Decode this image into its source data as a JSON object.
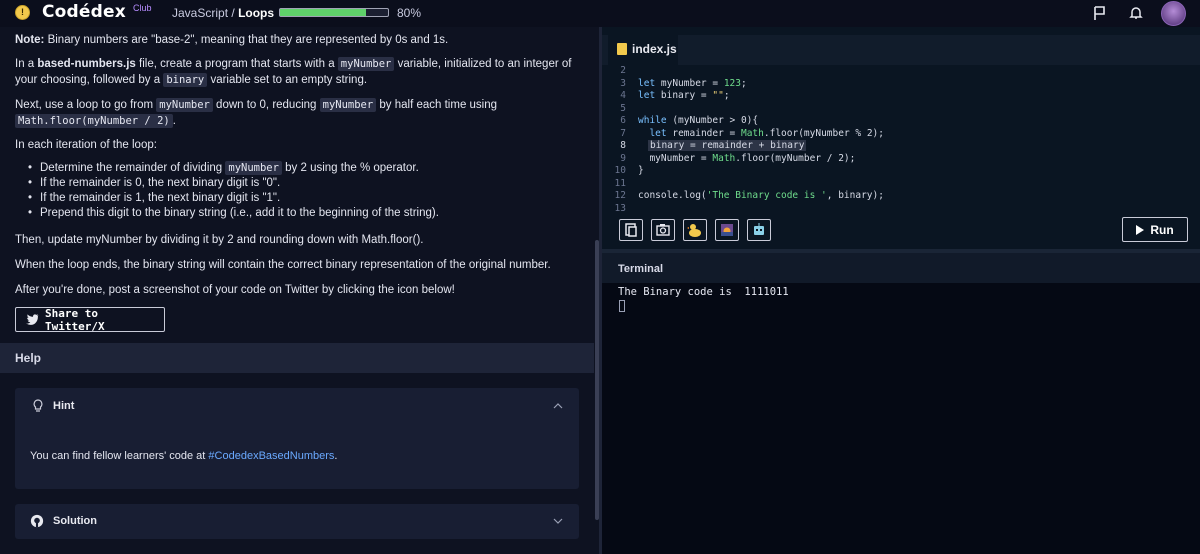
{
  "header": {
    "logo_mark": "!",
    "logo_text": "Codédex",
    "logo_badge": "Club",
    "breadcrumb_course": "JavaScript",
    "breadcrumb_sep": "/",
    "breadcrumb_lesson": "Loops",
    "progress_percent": 80,
    "progress_label": "80%"
  },
  "lesson": {
    "note_label": "Note:",
    "note_text": " Binary numbers are \"base-2\", meaning that they are represented by 0s and 1s.",
    "p1_a": "In a ",
    "p1_file": "based-numbers.js",
    "p1_b": " file, create a program that starts with a ",
    "p1_code1": "myNumber",
    "p1_c": " variable, initialized to an integer of your choosing, followed by a ",
    "p1_code2": "binary",
    "p1_d": " variable set to an empty string.",
    "p2_a": "Next, use a loop to go from ",
    "p2_code1": "myNumber",
    "p2_b": " down to 0, reducing ",
    "p2_code2": "myNumber",
    "p2_c": " by half each time using ",
    "p2_code3": "Math.floor(myNumber / 2)",
    "p2_d": ".",
    "p3": "In each iteration of the loop:",
    "bullet1_a": "Determine the remainder of dividing ",
    "bullet1_code": "myNumber",
    "bullet1_b": " by 2 using the % operator.",
    "bullet2": "If the remainder is 0, the next binary digit is \"0\".",
    "bullet3": "If the remainder is 1, the next binary digit is \"1\".",
    "bullet4": "Prepend this digit to the binary string (i.e., add it to the beginning of the string).",
    "p4": "Then, update myNumber by dividing it by 2 and rounding down with Math.floor().",
    "p5": "When the loop ends, the binary string will contain the correct binary representation of the original number.",
    "p6": "After you're done, post a screenshot of your code on Twitter by clicking the icon below!",
    "share_button": "Share to Twitter/X"
  },
  "help": {
    "title": "Help",
    "hint_title": "Hint",
    "hint_text": "You can find fellow learners' code at ",
    "hint_link": "#CodedexBasedNumbers",
    "hint_end": ".",
    "solution_title": "Solution"
  },
  "editor": {
    "tab_label": "index.js",
    "lines": [
      {
        "n": "2"
      },
      {
        "n": "3"
      },
      {
        "n": "4"
      },
      {
        "n": "5"
      },
      {
        "n": "6"
      },
      {
        "n": "7"
      },
      {
        "n": "8"
      },
      {
        "n": "9"
      },
      {
        "n": "10"
      },
      {
        "n": "11"
      },
      {
        "n": "12"
      },
      {
        "n": "13"
      }
    ],
    "code": {
      "l3_kw": "let",
      "l3_rest": " myNumber = ",
      "l3_num": "123",
      "l3_end": ";",
      "l4_kw": "let",
      "l4_rest": " binary = ",
      "l4_str": "\"\"",
      "l4_end": ";",
      "l6_kw": "while",
      "l6_rest": " (myNumber > 0){",
      "l7_kw": "let",
      "l7_a": " remainder = ",
      "l7_fn": "Math",
      "l7_b": ".floor(myNumber % 2);",
      "l8": "binary = remainder + binary",
      "l9_a": "myNumber = ",
      "l9_fn": "Math",
      "l9_b": ".floor(myNumber / 2);",
      "l10": "}",
      "l12_a": "console.log(",
      "l12_str": "'The Binary code is '",
      "l12_b": ", binary);"
    },
    "run_button": "Run"
  },
  "terminal": {
    "title": "Terminal",
    "output": "The Binary code is  1111011"
  }
}
